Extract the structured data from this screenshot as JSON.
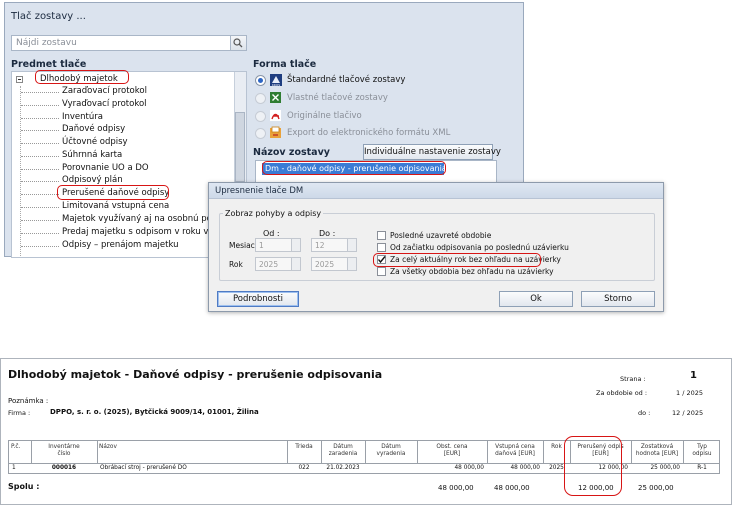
{
  "window": {
    "title": "Tlač zostavy ...",
    "search_placeholder": "Nájdi zostavu",
    "predmet_label": "Predmet tlače",
    "tree": {
      "root": "Dlhodobý majetok",
      "items": [
        "Zaraďovací protokol",
        "Vyraďovací protokol",
        "Inventúra",
        "Daňové odpisy",
        "Účtovné odpisy",
        "Súhrnná karta",
        "Porovnanie UO a DO",
        "Odpisový plán",
        "Prerušené daňové odpisy",
        "Limitovaná vstupná cena",
        "Majetok využívaný aj na osobnú potreb",
        "Predaj majetku s odpisom v roku vyrade",
        "Odpisy – prenájom majetku"
      ]
    },
    "forma_label": "Forma tlače",
    "forma_options": [
      {
        "label": "Štandardné tlačové zostavy",
        "selected": true,
        "enabled": true,
        "icon": "logo-icon"
      },
      {
        "label": "Vlastné tlačové zostavy",
        "selected": false,
        "enabled": false,
        "icon": "excel-icon"
      },
      {
        "label": "Originálne tlačivo",
        "selected": false,
        "enabled": false,
        "icon": "pdf-icon"
      },
      {
        "label": "Export do elektronického formátu XML",
        "selected": false,
        "enabled": false,
        "icon": "xml-export-icon"
      }
    ],
    "nazov_label": "Názov zostavy",
    "individual_button": "Individuálne nastavenie zostavy",
    "selected_report": "Dm - daňové odpisy - prerušenie odpisovania"
  },
  "dialog": {
    "title": "Upresnenie tlače DM",
    "group_title": "Zobraz pohyby a odpisy",
    "od_label": "Od :",
    "do_label": "Do :",
    "mesiac_label": "Mesiac",
    "rok_label": "Rok",
    "mesiac_od": "1",
    "mesiac_do": "12",
    "rok_od": "2025",
    "rok_do": "2025",
    "checkboxes": [
      {
        "label": "Posledné uzavreté obdobie",
        "checked": false
      },
      {
        "label": "Od začiatku odpisovania po poslednú uzávierku",
        "checked": false
      },
      {
        "label": "Za celý aktuálny rok bez ohľadu na uzávierky",
        "checked": true
      },
      {
        "label": "Za všetky obdobia bez ohľadu na uzávierky",
        "checked": false
      }
    ],
    "podrobnosti_button": "Podrobnosti",
    "ok_button": "Ok",
    "storno_button": "Storno"
  },
  "report": {
    "title": "Dlhodobý majetok - Daňové odpisy - prerušenie odpisovania",
    "strana_label": "Strana :",
    "strana_value": "1",
    "obdobie_od_label": "Za obdobie od :",
    "obdobie_od_value": "1 / 2025",
    "do_label": "do :",
    "do_value": "12 / 2025",
    "poznamka_label": "Poznámka :",
    "firma_label": "Firma :",
    "firma_value": "DPPO, s. r. o. (2025), Bytčická 9009/14, 01001, Žilina",
    "columns": [
      "P.č.",
      "Inventárne\nčíslo",
      "Názov",
      "Trieda",
      "Dátum\nzaradenia",
      "Dátum\nvyradenia",
      "Obst. cena\n[EUR]",
      "Vstupná cena\ndaňová [EUR]",
      "Rok",
      "Prerušený odpis\n[EUR]",
      "Zostatková\nhodnota [EUR]",
      "Typ\nodpisu"
    ],
    "row": [
      "1",
      "000016",
      "Obrábací stroj - prerušené DO",
      "022",
      "21.02.2023",
      "",
      "48 000,00",
      "48 000,00",
      "2025",
      "12 000,00",
      "25 000,00",
      "R-1"
    ],
    "total_label": "Spolu :",
    "totals": {
      "obst": "48 000,00",
      "vstupna": "48 000,00",
      "preruseny": "12 000,00",
      "zostatkova": "25 000,00"
    }
  },
  "colors": {
    "highlight_red": "#d71515",
    "selection_blue": "#3a7bd5"
  }
}
